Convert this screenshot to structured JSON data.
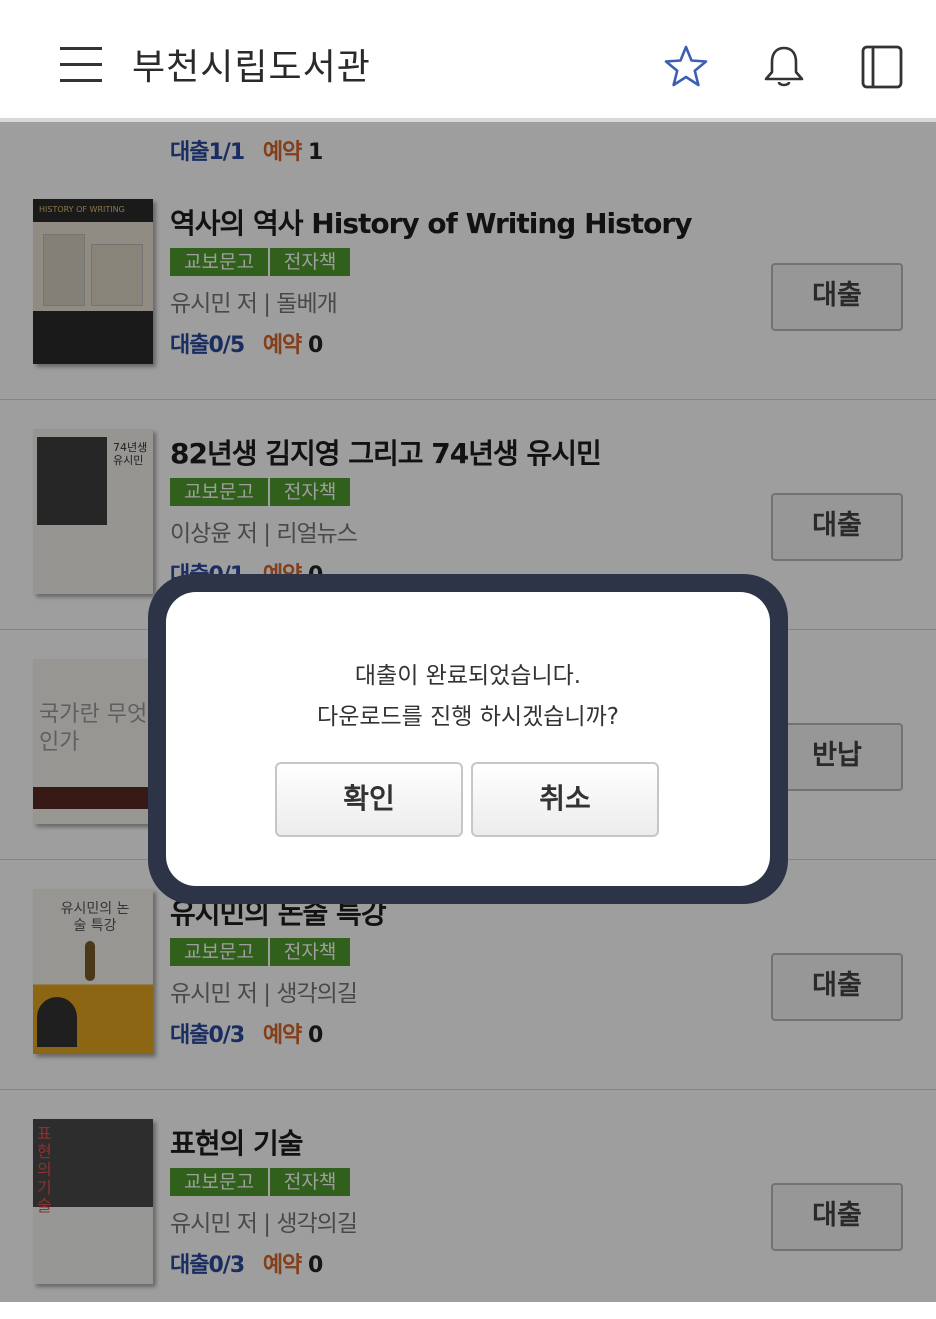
{
  "header": {
    "title": "부천시립도서관"
  },
  "partial_top_row": {
    "loan_label": "대출",
    "loan_value": "1/1",
    "reserve_label": "예약",
    "reserve_value": "1"
  },
  "books": [
    {
      "title": "역사의 역사 History of Writing History",
      "tags": [
        "교보문고",
        "전자책"
      ],
      "author": "유시민 저 | 돌베개",
      "loan_label": "대출",
      "loan_value": "0/5",
      "reserve_label": "예약",
      "reserve_value": "0",
      "action": "대출",
      "cover_text": "HISTORY OF WRITING"
    },
    {
      "title": "82년생 김지영 그리고 74년생 유시민",
      "tags": [
        "교보문고",
        "전자책"
      ],
      "author": "이상윤 저 | 리얼뉴스",
      "loan_label": "대출",
      "loan_value": "0/1",
      "reserve_label": "예약",
      "reserve_value": "0",
      "action": "대출",
      "cover_text": "74년생 유시민"
    },
    {
      "title": "",
      "tags": [],
      "author": "",
      "loan_label": "",
      "loan_value": "",
      "reserve_label": "",
      "reserve_value": "",
      "action": "반납",
      "cover_text": "국가란 무엇인가"
    },
    {
      "title": "유시민의 논술 특강",
      "tags": [
        "교보문고",
        "전자책"
      ],
      "author": "유시민 저 | 생각의길",
      "loan_label": "대출",
      "loan_value": "0/3",
      "reserve_label": "예약",
      "reserve_value": "0",
      "action": "대출",
      "cover_text": "유시민의 논술 특강"
    },
    {
      "title": "표현의 기술",
      "tags": [
        "교보문고",
        "전자책"
      ],
      "author": "유시민 저 | 생각의길",
      "loan_label": "대출",
      "loan_value": "0/3",
      "reserve_label": "예약",
      "reserve_value": "0",
      "action": "대출",
      "cover_text": "표현의 기술"
    }
  ],
  "dialog": {
    "line1": "대출이 완료되었습니다.",
    "line2": "다운로드를 진행 하시겠습니까?",
    "confirm_label": "확인",
    "cancel_label": "취소"
  },
  "colors": {
    "tag_green": "#4f9a2e",
    "loan_blue": "#2b4a9b",
    "reserve_orange": "#d4642a",
    "star_blue": "#3c5fb4",
    "dialog_frame": "#2e3448"
  },
  "icons": {
    "menu": "hamburger-icon",
    "favorite": "star-icon",
    "notification": "bell-icon",
    "my_library": "book-icon"
  }
}
